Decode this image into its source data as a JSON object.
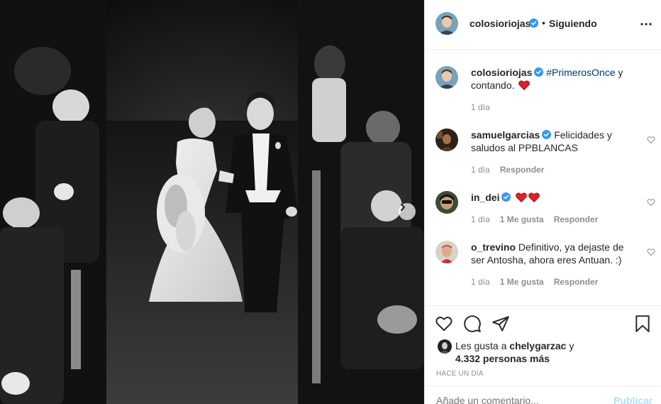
{
  "post": {
    "author": "colosioriojas",
    "follow_separator": "•",
    "follow_status": "Siguiendo",
    "caption_hashtag": "#PrimerosOnce",
    "caption_rest": " y contando.",
    "caption_time": "1 día"
  },
  "comments": [
    {
      "user": "samuelgarcias",
      "verified": true,
      "text": "Felicidades y saludos al PPBLANCAS",
      "time": "1 día",
      "likes": "",
      "reply": "Responder"
    },
    {
      "user": "in_dei",
      "verified": true,
      "text": "",
      "time": "1 día",
      "likes": "1 Me gusta",
      "reply": "Responder"
    },
    {
      "user": "o_trevino",
      "verified": false,
      "text": "Definitivo, ya dejaste de ser Antosha, ahora eres Antuan. :)",
      "time": "1 día",
      "likes": "1 Me gusta",
      "reply": "Responder"
    }
  ],
  "likes": {
    "prefix": "Les gusta a ",
    "user": "chelygarzac",
    "middle": " y",
    "count": "4.332 personas más"
  },
  "time_ago": "HACE UN DÍA",
  "add_comment": {
    "placeholder": "Añade un comentario...",
    "post_label": "Publicar"
  },
  "colors": {
    "verified": "#3897f0",
    "heart": "#ed4956",
    "hashtag": "#00376b",
    "muted": "#8e8e8e"
  },
  "icons": [
    "more-horizontal-icon",
    "heart-icon",
    "comment-icon",
    "share-icon",
    "bookmark-icon",
    "chevron-right-icon",
    "verified-badge-icon"
  ]
}
